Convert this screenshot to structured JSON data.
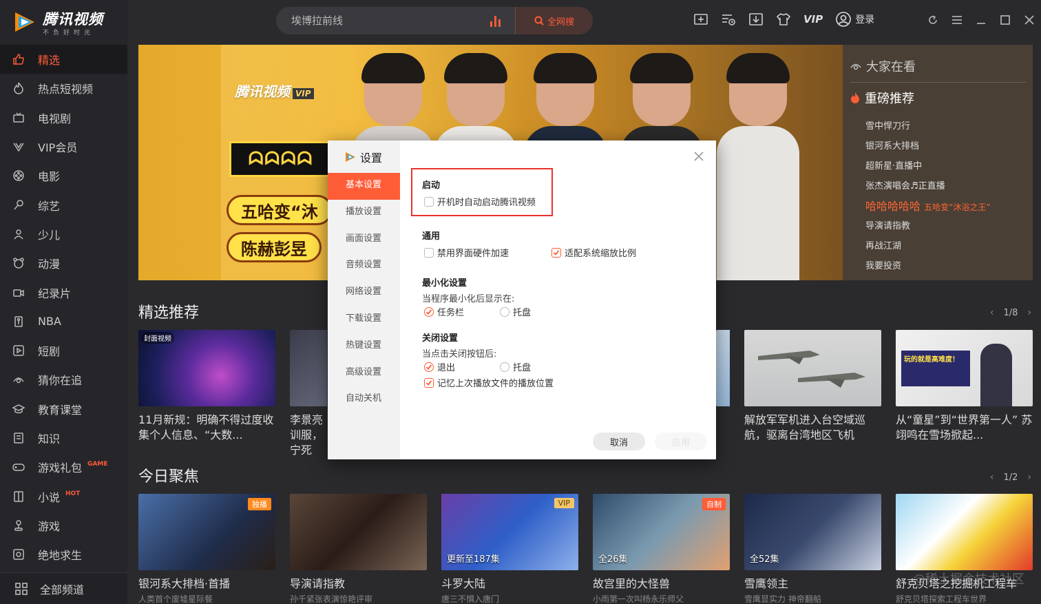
{
  "app": {
    "name": "腾讯视频",
    "slogan": "不负好时光"
  },
  "sidebar": {
    "items": [
      {
        "label": "精选",
        "icon": "thumbs-up-icon",
        "active": true
      },
      {
        "label": "热点短视频",
        "icon": "flame-icon"
      },
      {
        "label": "电视剧",
        "icon": "tv-icon"
      },
      {
        "label": "VIP会员",
        "icon": "vip-crown-icon"
      },
      {
        "label": "电影",
        "icon": "film-reel-icon"
      },
      {
        "label": "综艺",
        "icon": "microphone-icon"
      },
      {
        "label": "少儿",
        "icon": "kid-icon"
      },
      {
        "label": "动漫",
        "icon": "animation-icon"
      },
      {
        "label": "纪录片",
        "icon": "camera-icon"
      },
      {
        "label": "NBA",
        "icon": "nba-icon"
      },
      {
        "label": "短剧",
        "icon": "play-square-icon"
      },
      {
        "label": "猜你在追",
        "icon": "eye-icon"
      },
      {
        "label": "教育课堂",
        "icon": "graduation-icon"
      },
      {
        "label": "知识",
        "icon": "book-icon"
      },
      {
        "label": "游戏礼包",
        "icon": "gamepad-icon",
        "badge": "GAME"
      },
      {
        "label": "小说",
        "icon": "novel-icon",
        "badge": "HOT"
      },
      {
        "label": "游戏",
        "icon": "joystick-icon"
      },
      {
        "label": "绝地求生",
        "icon": "target-icon"
      }
    ],
    "all_channels": "全部频道"
  },
  "topbar": {
    "search_placeholder": "埃博拉前线",
    "search_button": "全网搜",
    "vip": "VIP",
    "login": "登录"
  },
  "banner": {
    "brand": "腾讯视频",
    "brand_tag": "VIP",
    "line1": "五哈变“沐",
    "line2": "陈赫彭昱"
  },
  "trending": {
    "header": "大家在看",
    "rec": "重磅推荐",
    "items": [
      {
        "text": "雪中悍刀行"
      },
      {
        "text": "银河系大排档"
      },
      {
        "text": "超新星·直播中"
      },
      {
        "text": "张杰演唱会♬正直播"
      },
      {
        "text": "哈哈哈哈哈",
        "sub": "五哈变“沐浴之王”",
        "hot": true
      },
      {
        "text": "导演请指教"
      },
      {
        "text": "再战江湖"
      },
      {
        "text": "我要投资"
      }
    ]
  },
  "section1": {
    "title": "精选推荐",
    "pager": "1/8",
    "cards": [
      {
        "caption": "11月新规：明确不得过度收集个人信息、“大数...",
        "badge": "封面视频"
      },
      {
        "caption": "李景亮训服，宁死"
      },
      {
        "caption": "解放军军机进入台空域巡航，驱离台湾地区飞机"
      },
      {
        "caption": "从“童星”到“世界第一人” 苏翊鸣在雪场掀起..."
      }
    ]
  },
  "section2": {
    "title": "今日聚焦",
    "pager": "1/2",
    "cards": [
      {
        "caption": "银河系大排档·首播",
        "tag": "独播",
        "sub": "人类首个废墟星际餐"
      },
      {
        "caption": "导演请指教",
        "sub": "孙千紧张表演惊艳评审"
      },
      {
        "caption": "斗罗大陆",
        "tag": "VIP",
        "count": "更新至187集",
        "sub": "唐三不惧入唐门"
      },
      {
        "caption": "故宫里的大怪兽",
        "tag": "自制",
        "count": "全26集",
        "sub": "小雨第一次叫杨永乐师父"
      },
      {
        "caption": "雪鹰领主",
        "count": "全52集",
        "sub": "雪鹰显实力 神帝翻船"
      },
      {
        "caption": "舒克贝塔之挖掘机工程车",
        "sub": "舒克贝塔探索工程车世界"
      }
    ]
  },
  "dialog": {
    "title": "设置",
    "menu": [
      "基本设置",
      "播放设置",
      "画面设置",
      "音频设置",
      "网络设置",
      "下载设置",
      "热键设置",
      "高级设置",
      "自动关机"
    ],
    "startup": {
      "title": "启动",
      "autostart": {
        "label": "开机时自动启动腾讯视频",
        "checked": false
      }
    },
    "general": {
      "title": "通用",
      "disable_hw": {
        "label": "禁用界面硬件加速",
        "checked": false
      },
      "fit_scale": {
        "label": "适配系统缩放比例",
        "checked": true
      }
    },
    "minimize": {
      "title": "最小化设置",
      "desc": "当程序最小化后显示在:",
      "opt_taskbar": {
        "label": "任务栏",
        "selected": true
      },
      "opt_tray": {
        "label": "托盘",
        "selected": false
      }
    },
    "close": {
      "title": "关闭设置",
      "desc": "当点击关闭按钮后:",
      "opt_exit": {
        "label": "退出",
        "selected": true
      },
      "opt_tray": {
        "label": "托盘",
        "selected": false
      },
      "remember": {
        "label": "记忆上次播放文件的播放位置",
        "checked": true
      }
    },
    "cancel": "取消",
    "apply": "应用"
  },
  "watermark": "@稀土掘金技术社区",
  "colors": {
    "accent": "#ff5c38",
    "highlight": "#e8322b"
  }
}
